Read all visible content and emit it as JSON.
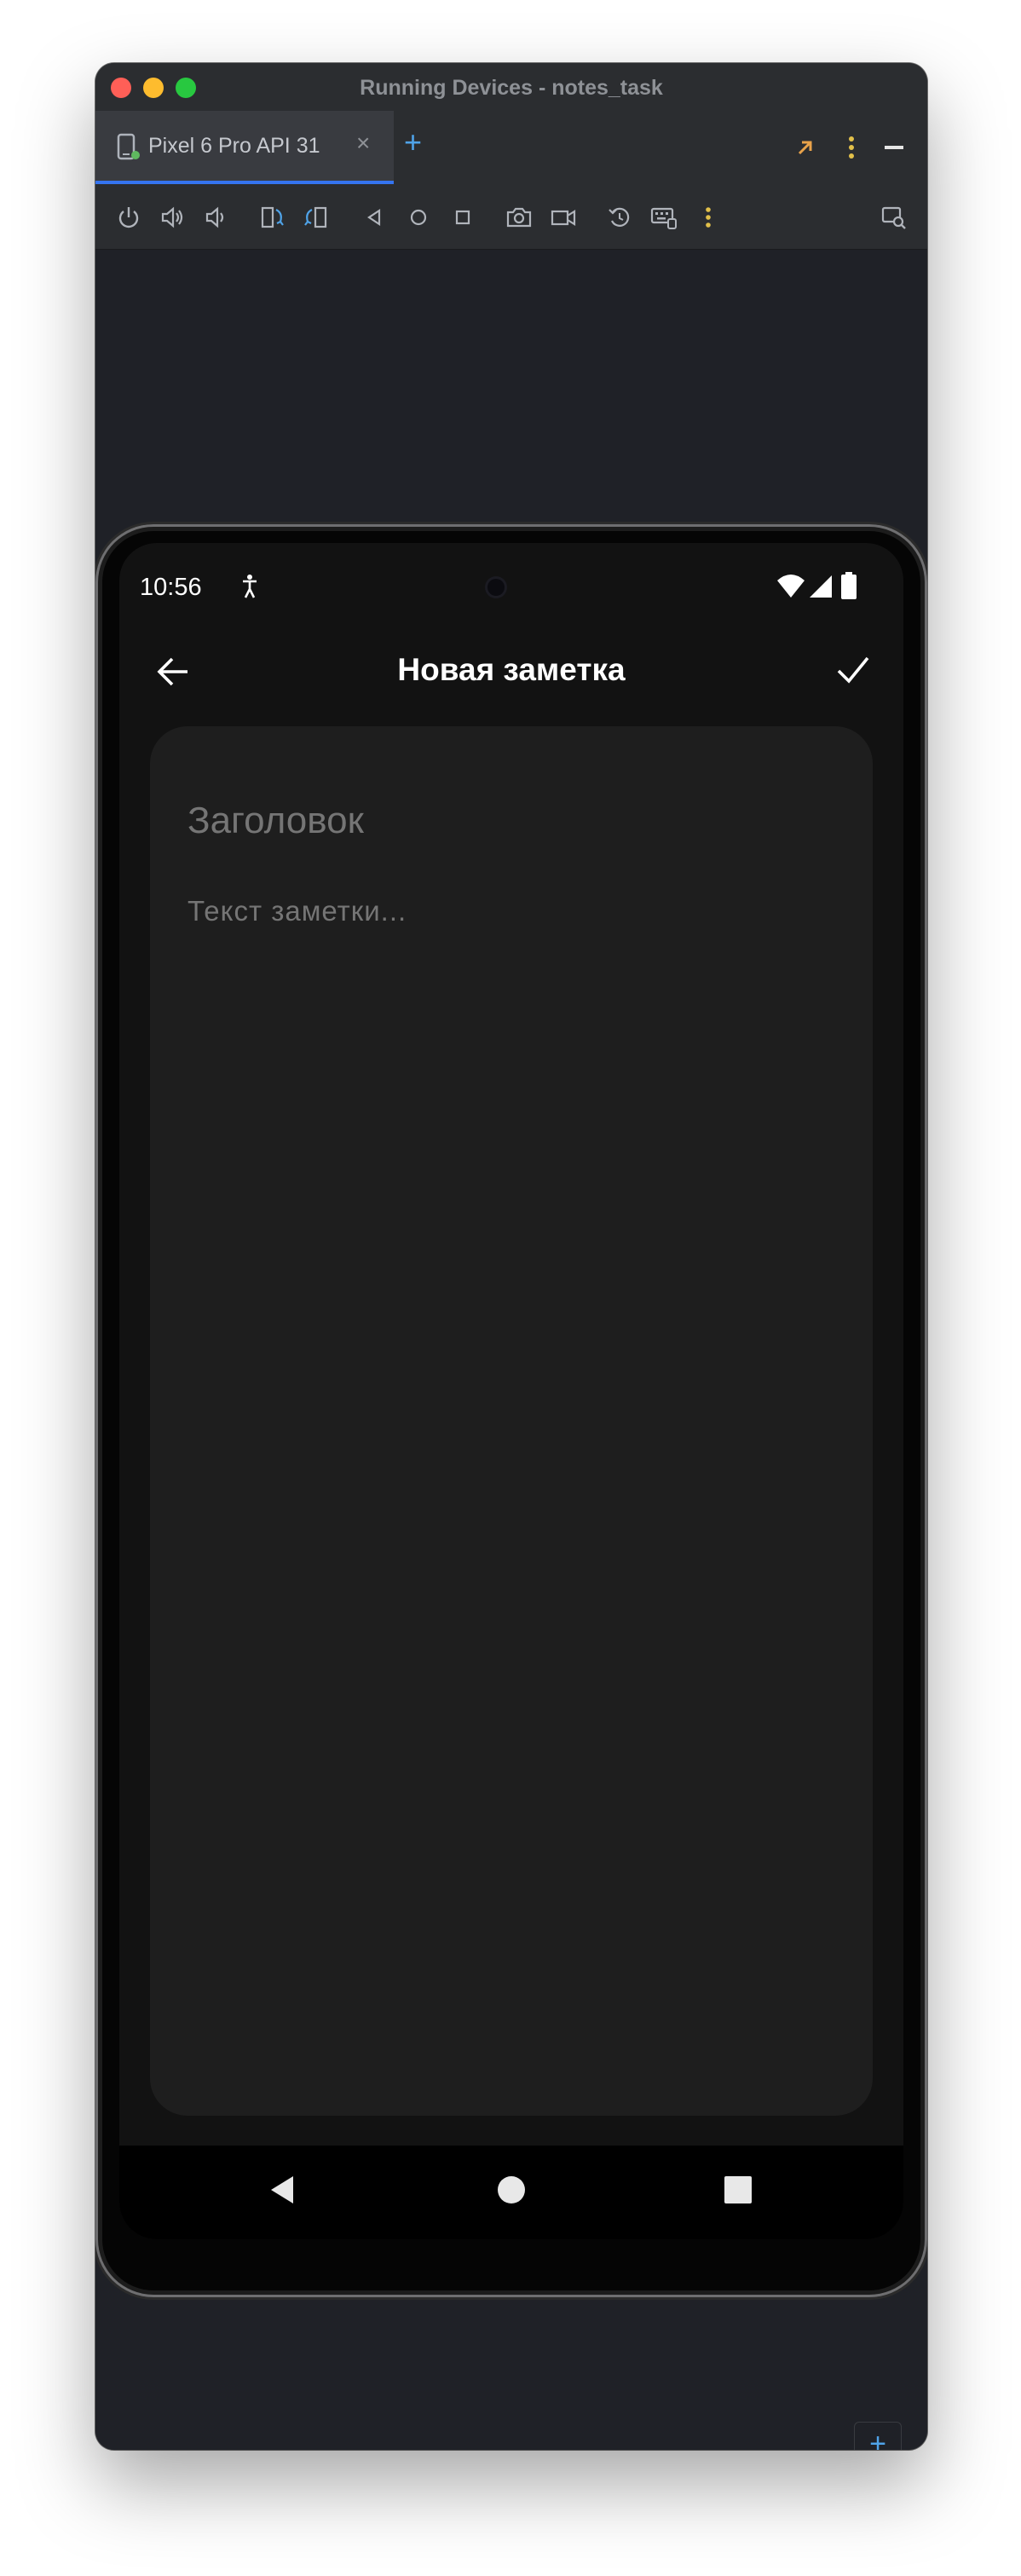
{
  "window": {
    "title": "Running Devices - notes_task"
  },
  "tabs": [
    {
      "label": "Pixel 6 Pro API 31",
      "close": "×",
      "active": true
    }
  ],
  "tab_add": "+",
  "toolbar_icons": [
    "power-icon",
    "volume-up-icon",
    "volume-down-icon",
    "rotate-left-icon",
    "rotate-right-icon",
    "back-icon",
    "home-icon",
    "overview-icon",
    "screenshot-icon",
    "screen-record-icon",
    "reset-icon",
    "keyboard-icon",
    "more-icon",
    "device-mirror-icon"
  ],
  "device": {
    "status_time": "10:56",
    "app_title": "Новая заметка",
    "note": {
      "title_placeholder": "Заголовок",
      "body_placeholder": "Текст заметки..."
    }
  },
  "zoom_controls": {
    "zoom_in": "+",
    "zoom_out": "−"
  },
  "colors": {
    "accent": "#3574f0",
    "tab_add": "#4fa3e8",
    "screen_background": "#121212",
    "card_background": "#1e1e1e"
  }
}
